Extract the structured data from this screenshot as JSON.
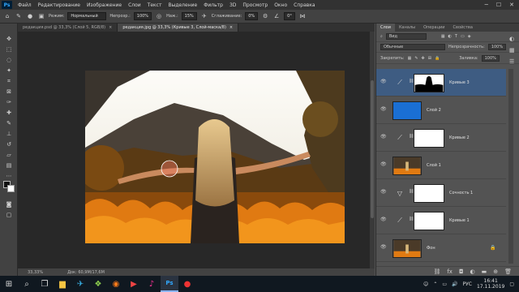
{
  "menu": {
    "logo": "Ps",
    "items": [
      "Файл",
      "Редактирование",
      "Изображение",
      "Слои",
      "Текст",
      "Выделение",
      "Фильтр",
      "3D",
      "Просмотр",
      "Окно",
      "Справка"
    ]
  },
  "options": {
    "mode_label": "Режим:",
    "mode_value": "Нормальный",
    "opacity_label": "Непрозр.:",
    "opacity_value": "100%",
    "pressure_label": "Наж.:",
    "pressure_value": "15%",
    "smoothing_label": "Сглаживание:",
    "smoothing_value": "0%",
    "angle_value": "0°"
  },
  "tabs": [
    {
      "label": "редакция.psd @ 33,3% (Слой 5, RGB/8)",
      "close": "×"
    },
    {
      "label": "редакция.jpg @ 33,3% (Кривые 3, Слой-маска/8)",
      "close": "×"
    }
  ],
  "status": {
    "zoom": "33,33%",
    "doc": "Док: 60,9M/17,6M"
  },
  "panel": {
    "tabs": [
      "Слои",
      "Каналы",
      "Операции",
      "Свойства"
    ],
    "kind_filter": "Вид",
    "blend_mode": "Обычные",
    "opacity_label": "Непрозрачность:",
    "opacity_value": "100%",
    "lock_label": "Закрепить:",
    "fill_label": "Заливка:",
    "fill_value": "100%"
  },
  "layers": [
    {
      "name": "Кривые 3",
      "kind": "curves",
      "selected": true,
      "mask": "black-silhouette"
    },
    {
      "name": "Слой 2",
      "kind": "fill",
      "color": "#1a6fd4"
    },
    {
      "name": "Кривые 2",
      "kind": "curves"
    },
    {
      "name": "Слой 1",
      "kind": "photo"
    },
    {
      "name": "Сочность 1",
      "kind": "vibrance"
    },
    {
      "name": "Кривые 1",
      "kind": "curves"
    },
    {
      "name": "Фон",
      "kind": "photo-bg",
      "locked": true
    }
  ],
  "taskbar": {
    "lang": "РУС",
    "time": "16:41",
    "date": "17.11.2019"
  },
  "colors": {
    "accent": "#31a8ff",
    "selected_layer": "#3e5c82",
    "fill_layer": "#1a6fd4"
  }
}
